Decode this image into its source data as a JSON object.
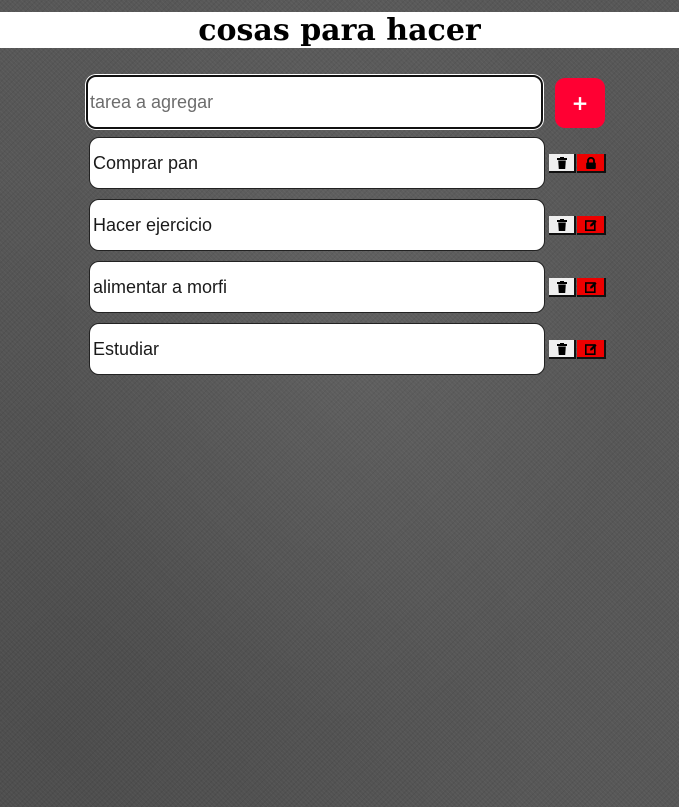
{
  "header": {
    "title": "cosas para hacer"
  },
  "new_task": {
    "placeholder": "tarea a agregar",
    "value": "",
    "add_label": "+"
  },
  "tasks": [
    {
      "text": "Comprar pan",
      "action_icon": "lock-icon"
    },
    {
      "text": "Hacer ejercicio",
      "action_icon": "edit-icon"
    },
    {
      "text": "alimentar a morfi",
      "action_icon": "edit-icon"
    },
    {
      "text": "Estudiar",
      "action_icon": "edit-icon"
    }
  ],
  "colors": {
    "accent": "#ff0033",
    "edit_button": "#ee0000",
    "delete_button": "#efefef",
    "background": "#565656"
  }
}
